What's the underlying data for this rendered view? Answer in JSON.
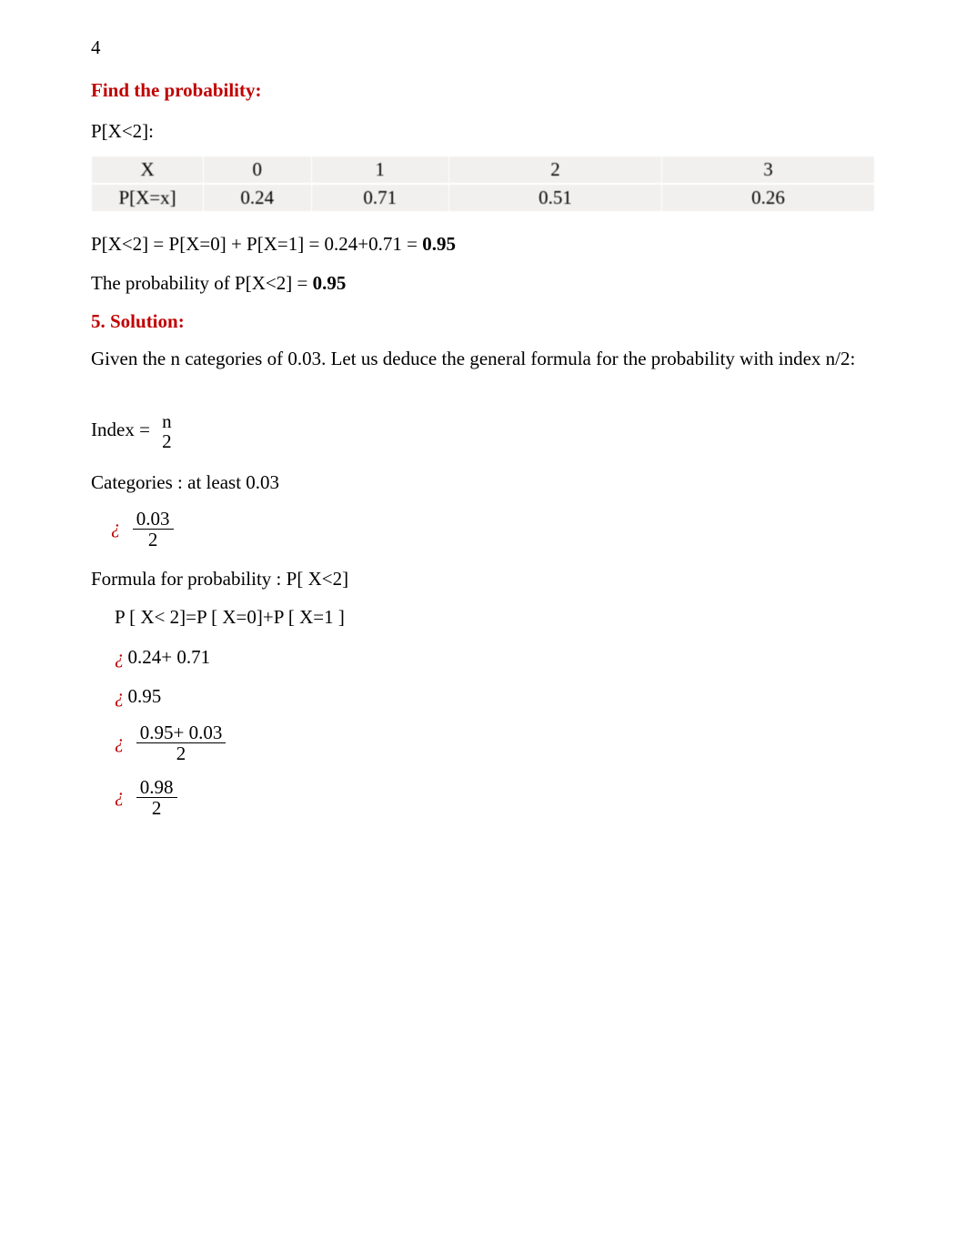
{
  "page_number": "4",
  "heading1": "Find the probability:",
  "line_pxlt2": "P[X<2]:",
  "table": {
    "row1": {
      "h": "X",
      "c0": "0",
      "c1": "1",
      "c2": "2",
      "c3": "3"
    },
    "row2": {
      "h": "P[X=x]",
      "c0": "0.24",
      "c1": "0.71",
      "c2": "0.51",
      "c3": "0.26"
    }
  },
  "eq1_left": "P[X<2] = P[X=0] + P[X=1] =  0.24+0.71 = ",
  "eq1_result": "0.95",
  "eq2_left": "The probability of P[X<2] = ",
  "eq2_result": "0.95",
  "solution_head": "5. Solution:",
  "para_given": " Given the n categories of 0.03. Let us deduce the general formula for the probability with index n/2:",
  "index_label": "Index =  ",
  "index_num": "n",
  "index_den": "2",
  "categories_line": "Categories : at least 0.03",
  "iqm": "¿",
  "frac_003_num": "0.03",
  "frac_003_den": "2",
  "formula_label": "Formula for probability   : ",
  "formula_expr": "P[ X<2]",
  "m1": "P [ X< 2]=P [ X=0]+P [ X=1 ]",
  "m2": "0.24+ 0.71",
  "m3": "0.95",
  "m4_num": "0.95+ 0.03",
  "m4_den": "2",
  "m5_num": "0.98",
  "m5_den": "2"
}
